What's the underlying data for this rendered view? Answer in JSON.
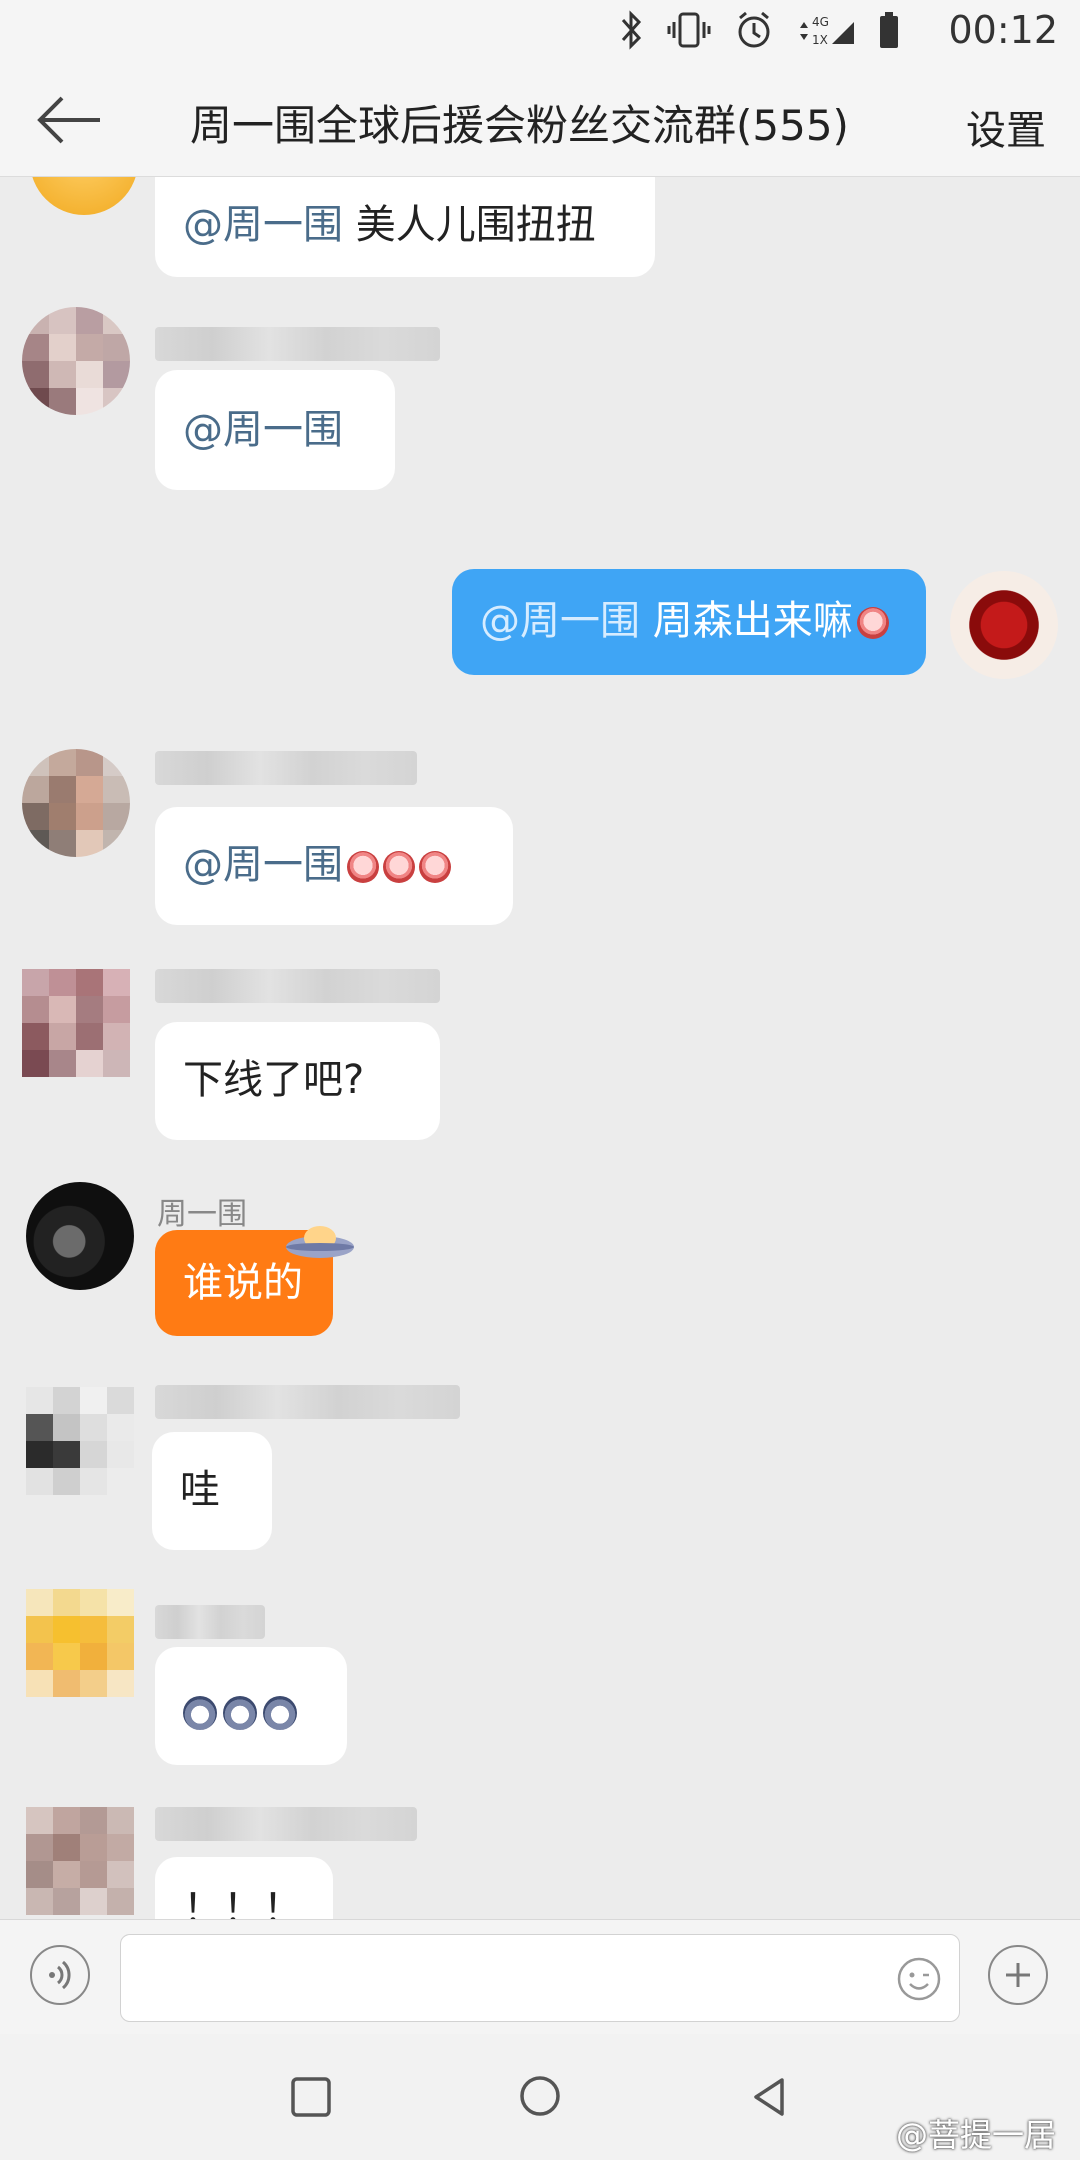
{
  "status_bar": {
    "time": "00:12",
    "network": "4G 1X"
  },
  "header": {
    "title": "周一围全球后援会粉丝交流群(555)",
    "settings_label": "设置"
  },
  "messages": [
    {
      "mention": "@周一围",
      "text": " 美人儿围扭扭"
    },
    {
      "mention": "@周一围",
      "text": ""
    },
    {
      "mention": "@周一围",
      "text": " 周森出来嘛"
    },
    {
      "mention": "@周一围",
      "text": ""
    },
    {
      "text": "下线了吧?"
    },
    {
      "sender": "周一围",
      "text": "谁说的"
    },
    {
      "text": "哇"
    },
    {
      "text": ""
    },
    {
      "text": "！！！"
    }
  ],
  "input": {
    "placeholder": ""
  },
  "watermark": "@菩提一居"
}
